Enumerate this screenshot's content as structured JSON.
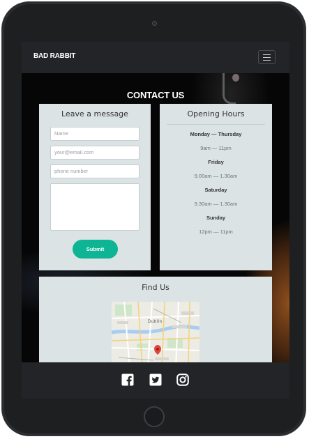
{
  "navbar": {
    "brand": "BAD RABBIT"
  },
  "contact": {
    "title": "CONTACT US",
    "message_form": {
      "title": "Leave a message",
      "name_placeholder": "Name",
      "email_placeholder": "your@email.com",
      "phone_placeholder": "phone number",
      "submit_label": "Submit"
    },
    "opening_hours": {
      "title": "Opening Hours",
      "rows": [
        {
          "day": "Monday — Thursday",
          "time": "9am — 11pm"
        },
        {
          "day": "Friday",
          "time": "9.00am — 1.30am"
        },
        {
          "day": "Saturday",
          "time": "9.30am — 1.30am"
        },
        {
          "day": "Sunday",
          "time": "12pm — 11pm"
        }
      ]
    },
    "find_us": {
      "title": "Find Us",
      "map_label": "Dublin"
    }
  },
  "footer": {
    "icons": [
      "facebook-icon",
      "twitter-icon",
      "instagram-icon"
    ]
  },
  "colors": {
    "navbar": "#222427",
    "card": "#dce3e5",
    "submit": "#0db594",
    "text": "#333333"
  }
}
